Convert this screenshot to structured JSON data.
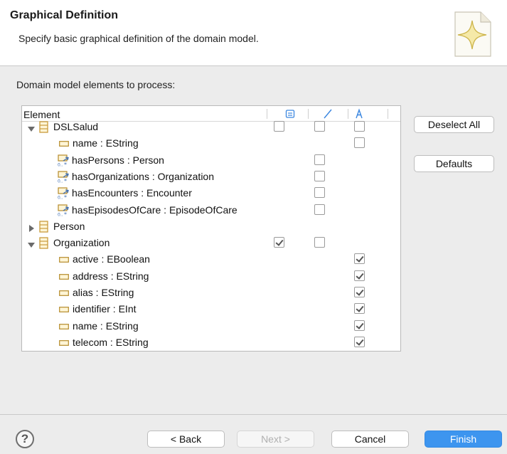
{
  "header": {
    "title": "Graphical Definition",
    "description": "Specify basic graphical definition of the domain model."
  },
  "section_label": "Domain model elements to process:",
  "tree": {
    "column_header": "Element",
    "rows": [
      {
        "label": "DSLSalud",
        "kind": "class",
        "expanded": true,
        "level": 0,
        "node": false,
        "link": false,
        "label_col": false
      },
      {
        "label": "name : EString",
        "kind": "attribute",
        "level": 1,
        "node": null,
        "link": null,
        "label_col": false
      },
      {
        "label": "hasPersons : Person",
        "kind": "reference",
        "level": 1,
        "node": null,
        "link": false,
        "label_col": null
      },
      {
        "label": "hasOrganizations : Organization",
        "kind": "reference",
        "level": 1,
        "node": null,
        "link": false,
        "label_col": null
      },
      {
        "label": "hasEncounters : Encounter",
        "kind": "reference",
        "level": 1,
        "node": null,
        "link": false,
        "label_col": null
      },
      {
        "label": "hasEpisodesOfCare : EpisodeOfCare",
        "kind": "reference",
        "level": 1,
        "node": null,
        "link": false,
        "label_col": null
      },
      {
        "label": "Person",
        "kind": "class",
        "expanded": false,
        "level": 0,
        "node": null,
        "link": null,
        "label_col": null
      },
      {
        "label": "Organization",
        "kind": "class",
        "expanded": true,
        "level": 0,
        "node": true,
        "link": false,
        "label_col": null
      },
      {
        "label": "active : EBoolean",
        "kind": "attribute",
        "level": 1,
        "node": null,
        "link": null,
        "label_col": true
      },
      {
        "label": "address : EString",
        "kind": "attribute",
        "level": 1,
        "node": null,
        "link": null,
        "label_col": true
      },
      {
        "label": "alias : EString",
        "kind": "attribute",
        "level": 1,
        "node": null,
        "link": null,
        "label_col": true
      },
      {
        "label": "identifier : EInt",
        "kind": "attribute",
        "level": 1,
        "node": null,
        "link": null,
        "label_col": true
      },
      {
        "label": "name : EString",
        "kind": "attribute",
        "level": 1,
        "node": null,
        "link": null,
        "label_col": true
      },
      {
        "label": "telecom : EString",
        "kind": "attribute",
        "level": 1,
        "node": null,
        "link": null,
        "label_col": true
      }
    ]
  },
  "side_buttons": {
    "deselect_all": "Deselect All",
    "defaults": "Defaults"
  },
  "footer": {
    "help": "?",
    "back": "< Back",
    "next": "Next >",
    "cancel": "Cancel",
    "finish": "Finish"
  },
  "colors": {
    "primary_button": "#3d95ef",
    "header_column_icon": "#3a86e0",
    "class_icon": "#c89b3c",
    "reference_icon": "#3f6fb5"
  }
}
